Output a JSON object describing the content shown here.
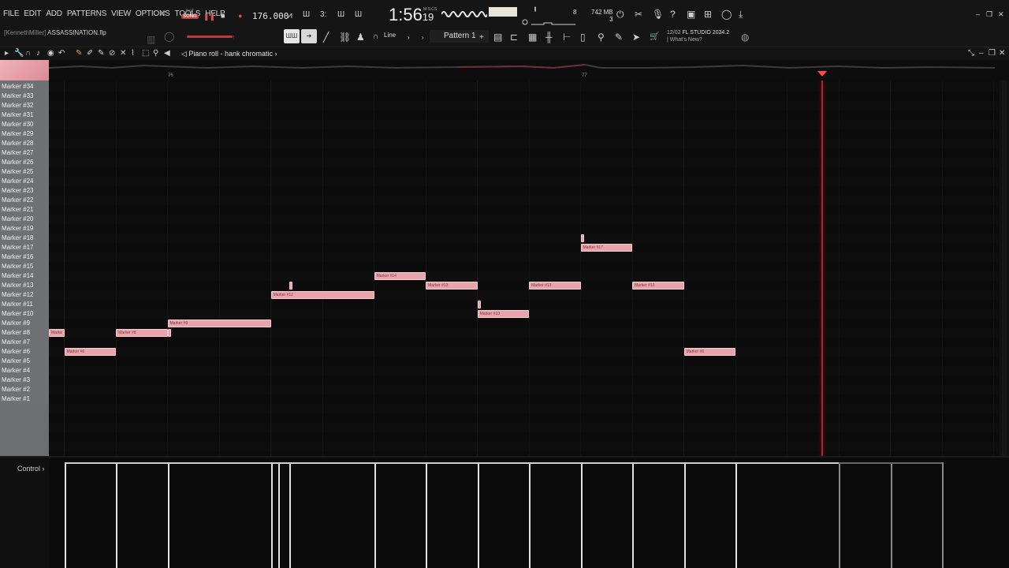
{
  "menu": [
    "FILE",
    "EDIT",
    "ADD",
    "PATTERNS",
    "VIEW",
    "OPTIONS",
    "TOOLS",
    "HELP"
  ],
  "file_info": {
    "user": "[KennethMiller]",
    "filename": "ASSASSINATION.flp"
  },
  "transport": {
    "pat_label": "PAT",
    "song_label": "SONG",
    "tempo": "176.000",
    "time_main": "1:56",
    "time_frac": "19",
    "time_unit": "M:S:CS"
  },
  "monitor": {
    "cpu": "8",
    "mem": "742 MB",
    "mem_sub": "3"
  },
  "toolbar": {
    "snap": "Line",
    "pattern": "Pattern 1",
    "news_date": "12/02",
    "news_version": "FL STUDIO 2024.2",
    "news_link": "| What's New?"
  },
  "piano_roll": {
    "title": "Piano roll - hank chromatic",
    "bar_numbers": [
      "76",
      "77"
    ]
  },
  "markers": [
    "Marker #34",
    "Marker #33",
    "Marker #32",
    "Marker #31",
    "Marker #30",
    "Marker #29",
    "Marker #28",
    "Marker #27",
    "Marker #26",
    "Marker #25",
    "Marker #24",
    "Marker #23",
    "Marker #22",
    "Marker #21",
    "Marker #20",
    "Marker #19",
    "Marker #18",
    "Marker #17",
    "Marker #16",
    "Marker #15",
    "Marker #14",
    "Marker #13",
    "Marker #12",
    "Marker #11",
    "Marker #10",
    "Marker #9",
    "Marker #8",
    "Marker #7",
    "Marker #6",
    "Marker #5",
    "Marker #4",
    "Marker #3",
    "Marker #2",
    "Marker #1"
  ],
  "notes": [
    {
      "label": "Marke",
      "row": 26,
      "start": 0,
      "len": 1.5
    },
    {
      "label": "Marker #6",
      "row": 28,
      "start": 1.5,
      "len": 5
    },
    {
      "label": "Marker #8",
      "row": 26,
      "start": 6.5,
      "len": 5
    },
    {
      "label": "",
      "row": 26,
      "start": 11.5,
      "len": 0.3
    },
    {
      "label": "Marker #9",
      "row": 25,
      "start": 11.5,
      "len": 10
    },
    {
      "label": "",
      "row": 21,
      "start": 23.3,
      "len": 0.3
    },
    {
      "label": "Marker #12",
      "row": 22,
      "start": 21.5,
      "len": 10
    },
    {
      "label": "Marker #14",
      "row": 20,
      "start": 31.5,
      "len": 5
    },
    {
      "label": "Marker #13",
      "row": 21,
      "start": 36.5,
      "len": 5
    },
    {
      "label": "",
      "row": 23,
      "start": 41.5,
      "len": 0.3
    },
    {
      "label": "Marker #10",
      "row": 24,
      "start": 41.5,
      "len": 5
    },
    {
      "label": "Marker #13",
      "row": 21,
      "start": 46.5,
      "len": 5
    },
    {
      "label": "",
      "row": 16,
      "start": 51.5,
      "len": 0.3
    },
    {
      "label": "Marker #17",
      "row": 17,
      "start": 51.5,
      "len": 5
    },
    {
      "label": "Marker #13",
      "row": 21,
      "start": 56.5,
      "len": 5
    },
    {
      "label": "Marker #6",
      "row": 28,
      "start": 61.5,
      "len": 5
    }
  ],
  "control": {
    "label": "Control"
  },
  "velocity_steps": [
    1.5,
    6.5,
    11.5,
    21.5,
    22.2,
    23.3,
    31.5,
    36.5,
    41.5,
    46.5,
    51.5,
    56.5,
    61.5,
    66.5,
    76.5,
    81.5,
    86.5
  ]
}
